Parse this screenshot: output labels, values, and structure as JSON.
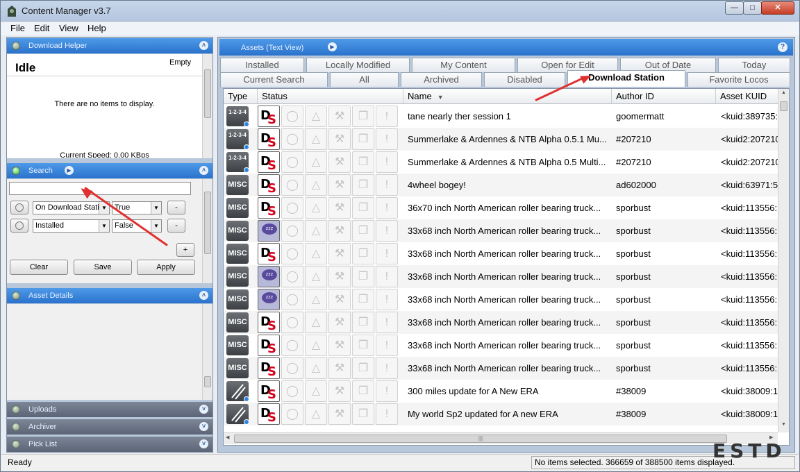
{
  "window": {
    "title": "Content Manager v3.7"
  },
  "menu": [
    "File",
    "Edit",
    "View",
    "Help"
  ],
  "download_helper": {
    "label": "Download Helper",
    "status": "Idle",
    "queue": "Empty",
    "empty_msg": "There are no items to display.",
    "speed": "Current Speed: 0.00 KBps"
  },
  "search": {
    "label": "Search",
    "query_value": "",
    "filters": [
      {
        "field": "On Download Station",
        "value": "True"
      },
      {
        "field": "Installed",
        "value": "False"
      }
    ],
    "remove_label": "-",
    "add_label": "+",
    "clear_label": "Clear",
    "save_label": "Save",
    "apply_label": "Apply"
  },
  "asset_details": {
    "label": "Asset Details"
  },
  "bottom_panes": [
    "Uploads",
    "Archiver",
    "Pick List"
  ],
  "assets": {
    "label": "Assets (Text View)",
    "help": "?"
  },
  "tabs_row1": [
    "Installed",
    "Locally Modified",
    "My Content",
    "Open for Edit",
    "Out of Date",
    "Today"
  ],
  "tabs_row2": [
    "Current Search",
    "All",
    "Archived",
    "Disabled",
    "Download Station",
    "Favorite Locos"
  ],
  "active_tab": "Download Station",
  "columns": [
    "Type",
    "Status",
    "Name",
    "Author ID",
    "Asset KUID"
  ],
  "rows": [
    {
      "type": "1-2-3-4",
      "status": "ds",
      "name": "tane nearly ther session 1",
      "author": "goomermatt",
      "kuid": "<kuid:389735:"
    },
    {
      "type": "1-2-3-4",
      "status": "ds",
      "name": "Summerlake & Ardennes & NTB Alpha 0.5.1 Mu...",
      "author": "#207210",
      "kuid": "<kuid2:207210"
    },
    {
      "type": "1-2-3-4",
      "status": "ds",
      "name": "Summerlake & Ardennes & NTB Alpha 0.5 Multi...",
      "author": "#207210",
      "kuid": "<kuid2:207210"
    },
    {
      "type": "MISC",
      "status": "ds",
      "name": "4wheel bogey!",
      "author": "ad602000",
      "kuid": "<kuid:63971:5"
    },
    {
      "type": "MISC",
      "status": "ds",
      "name": "36x70 inch North American roller bearing truck...",
      "author": "sporbust",
      "kuid": "<kuid:113556:"
    },
    {
      "type": "MISC",
      "status": "zz",
      "name": "33x68 inch North American roller bearing truck...",
      "author": "sporbust",
      "kuid": "<kuid:113556:"
    },
    {
      "type": "MISC",
      "status": "ds",
      "name": "33x68 inch North American roller bearing truck...",
      "author": "sporbust",
      "kuid": "<kuid:113556:"
    },
    {
      "type": "MISC",
      "status": "zz",
      "name": "33x68 inch North American roller bearing truck...",
      "author": "sporbust",
      "kuid": "<kuid:113556:"
    },
    {
      "type": "MISC",
      "status": "zz",
      "name": "33x68 inch North American roller bearing truck...",
      "author": "sporbust",
      "kuid": "<kuid:113556:"
    },
    {
      "type": "MISC",
      "status": "ds",
      "name": "33x68 inch North American roller bearing truck...",
      "author": "sporbust",
      "kuid": "<kuid:113556:"
    },
    {
      "type": "MISC",
      "status": "ds",
      "name": "33x68 inch North American roller bearing truck...",
      "author": "sporbust",
      "kuid": "<kuid:113556:"
    },
    {
      "type": "MISC",
      "status": "ds",
      "name": "33x68 inch North American roller bearing truck...",
      "author": "sporbust",
      "kuid": "<kuid:113556:"
    },
    {
      "type": "route",
      "status": "ds",
      "name": "300 miles update for A New ERA",
      "author": "#38009",
      "kuid": "<kuid:38009:1"
    },
    {
      "type": "route",
      "status": "ds",
      "name": "My world Sp2 updated for A new ERA",
      "author": "#38009",
      "kuid": "<kuid:38009:1"
    }
  ],
  "status": {
    "left": "Ready",
    "right": "No items selected. 366659 of 388500 items displayed."
  },
  "watermark": "ESTD"
}
